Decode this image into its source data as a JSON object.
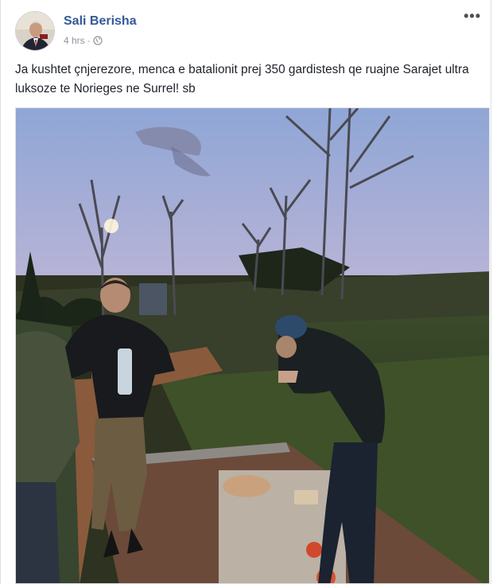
{
  "post": {
    "author": "Sali Berisha",
    "time": "4 hrs",
    "separator": "·",
    "privacy_icon": "globe-icon",
    "more_label": "•••",
    "text": "Ja kushtet çnjerezore, menca e batalionit prej 350 gardistesh qe ruajne Sarajet ultra luksoze te Norieges ne Surrel! sb"
  },
  "colors": {
    "author": "#365899",
    "meta": "#90949c",
    "text": "#1d2129"
  }
}
